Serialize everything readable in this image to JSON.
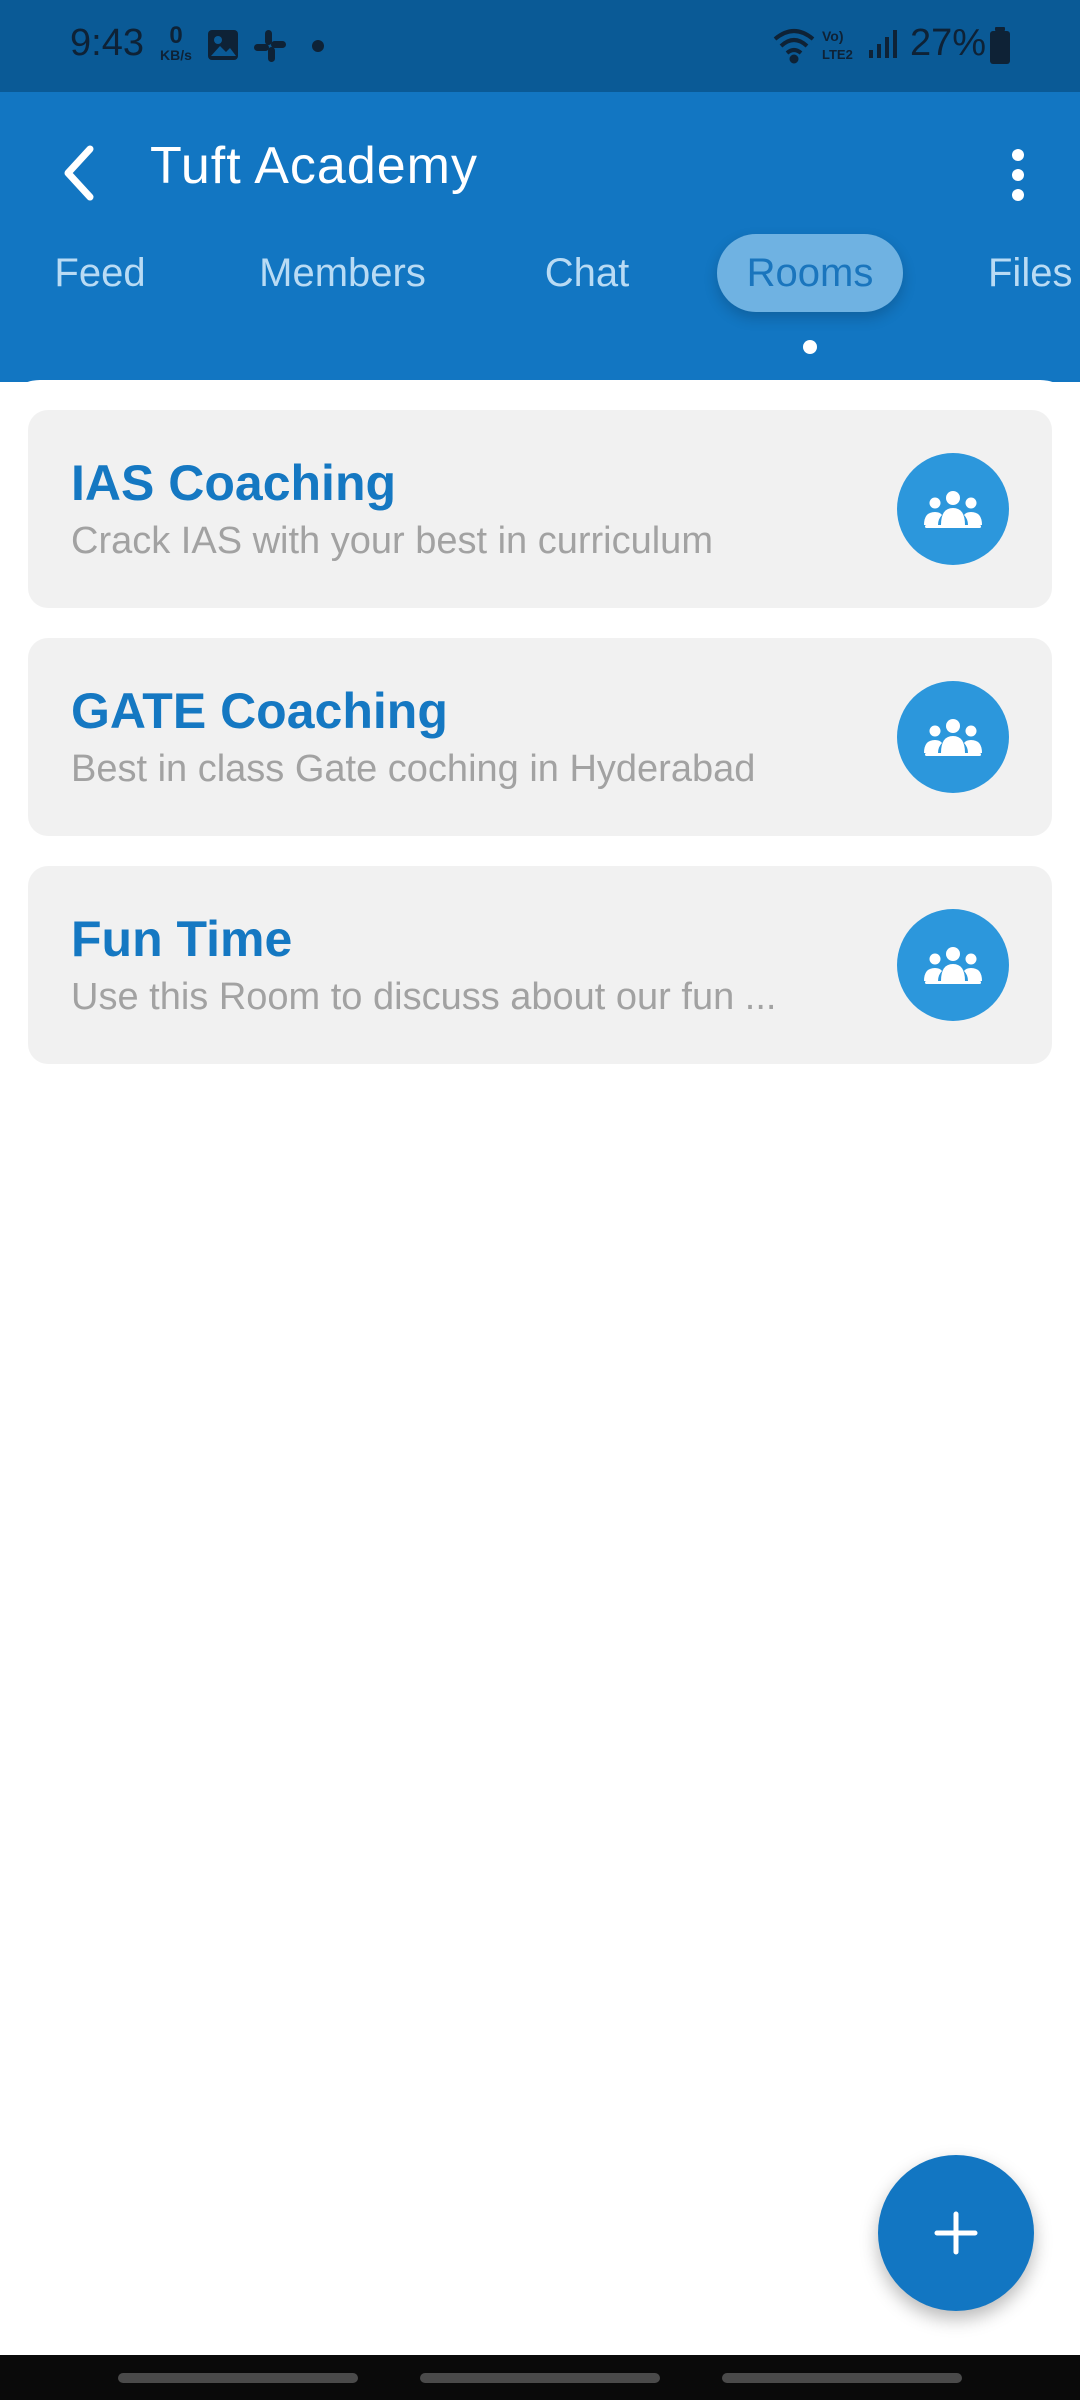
{
  "status_bar": {
    "time": "9:43",
    "net_speed_value": "0",
    "net_speed_unit": "KB/s",
    "battery": "27%",
    "icons": [
      "image-icon",
      "slack-icon",
      "wifi-icon",
      "volte-icon",
      "signal-icon",
      "battery-icon"
    ]
  },
  "header": {
    "title": "Tuft Academy",
    "back_icon": "chevron-left-icon",
    "menu_icon": "more-vertical-icon"
  },
  "tabs": [
    {
      "label": "Feed",
      "active": false
    },
    {
      "label": "Members",
      "active": false
    },
    {
      "label": "Chat",
      "active": false
    },
    {
      "label": "Rooms",
      "active": true
    },
    {
      "label": "Files",
      "active": false
    }
  ],
  "rooms": [
    {
      "title": "IAS Coaching",
      "description": "Crack IAS with your best in curriculum",
      "icon": "group-icon"
    },
    {
      "title": "GATE Coaching",
      "description": "Best in class Gate coching in Hyderabad",
      "icon": "group-icon"
    },
    {
      "title": "Fun Time",
      "description": "Use this Room to discuss about our fun ...",
      "icon": "group-icon"
    }
  ],
  "fab": {
    "icon": "plus-icon"
  },
  "colors": {
    "status_bar": "#0a5a96",
    "primary": "#1276c2",
    "active_tab_bg": "#6fb2e2",
    "inactive_tab_text": "#b9dbf4",
    "card_bg": "#f1f1f1",
    "room_title": "#1578c2",
    "room_desc": "#a2a2a2",
    "avatar_bg": "#2c97dc"
  }
}
